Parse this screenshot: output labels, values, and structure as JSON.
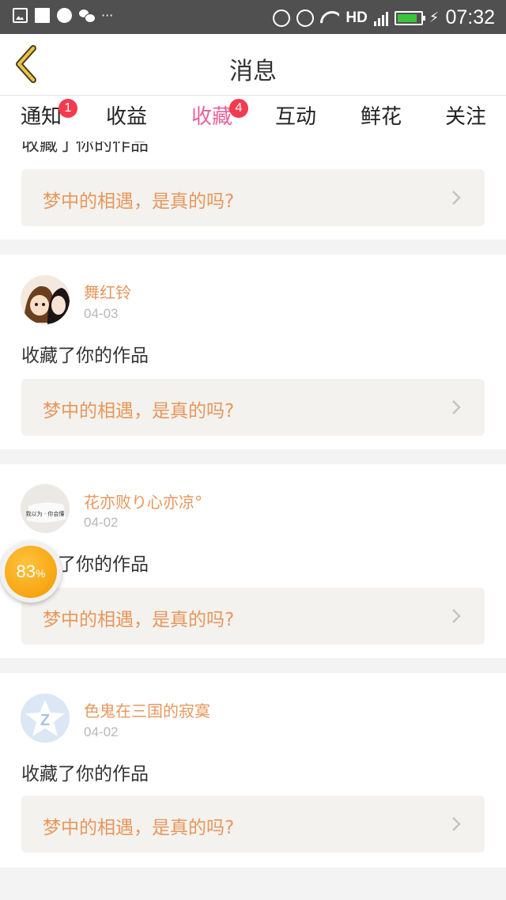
{
  "status_bar": {
    "left_icons": [
      "image-icon",
      "square-icon",
      "globe-icon",
      "wechat-icon"
    ],
    "dots": "···",
    "hd": "HD",
    "network": "4G",
    "sim": "1",
    "time": "07:32"
  },
  "header": {
    "title": "消息"
  },
  "tabs": [
    {
      "label": "通知",
      "badge": "1"
    },
    {
      "label": "收益"
    },
    {
      "label": "收藏",
      "badge": "4",
      "active": true
    },
    {
      "label": "互动"
    },
    {
      "label": "鲜花"
    },
    {
      "label": "关注"
    }
  ],
  "cards": [
    {
      "action": "收藏了你的作品",
      "work_title": "梦中的相遇，是真的吗?"
    },
    {
      "user": "舞红铃",
      "date": "04-03",
      "action": "收藏了你的作品",
      "work_title": "梦中的相遇，是真的吗?"
    },
    {
      "user": "花亦败り心亦凉°",
      "date": "04-02",
      "action": "收藏了你的作品",
      "work_title": "梦中的相遇，是真的吗?"
    },
    {
      "user": "色鬼在三国的寂寞",
      "date": "04-02",
      "action": "收藏了你的作品",
      "work_title": "梦中的相遇，是真的吗?"
    }
  ],
  "avatar2_text": "我以为 · 你会懂",
  "float_progress": {
    "value": "83",
    "unit": "%"
  },
  "colors": {
    "accent_pink": "#e8629a",
    "accent_orange": "#e8975c",
    "badge_red": "#f23b4e"
  }
}
